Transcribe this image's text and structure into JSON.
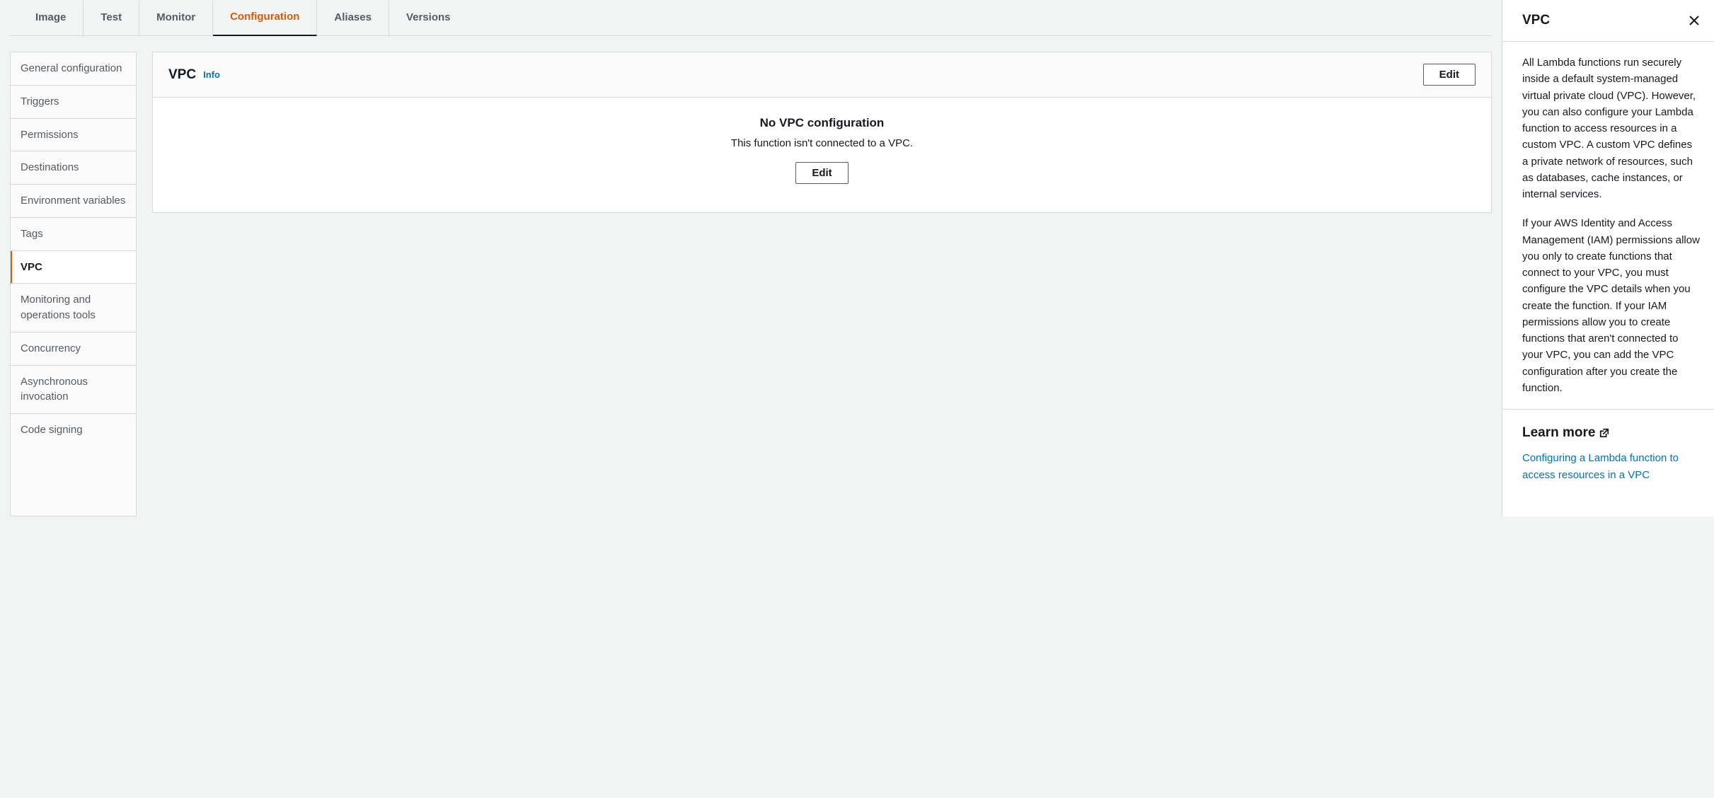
{
  "tabs": [
    {
      "label": "Image"
    },
    {
      "label": "Test"
    },
    {
      "label": "Monitor"
    },
    {
      "label": "Configuration"
    },
    {
      "label": "Aliases"
    },
    {
      "label": "Versions"
    }
  ],
  "sideNav": [
    {
      "label": "General configuration"
    },
    {
      "label": "Triggers"
    },
    {
      "label": "Permissions"
    },
    {
      "label": "Destinations"
    },
    {
      "label": "Environment variables"
    },
    {
      "label": "Tags"
    },
    {
      "label": "VPC"
    },
    {
      "label": "Monitoring and operations tools"
    },
    {
      "label": "Concurrency"
    },
    {
      "label": "Asynchronous invocation"
    },
    {
      "label": "Code signing"
    }
  ],
  "panel": {
    "title": "VPC",
    "infoLabel": "Info",
    "editLabel": "Edit",
    "emptyTitle": "No VPC configuration",
    "emptyText": "This function isn't connected to a VPC."
  },
  "help": {
    "title": "VPC",
    "para1": "All Lambda functions run securely inside a default system-managed virtual private cloud (VPC). However, you can also configure your Lambda function to access resources in a custom VPC. A custom VPC defines a private network of resources, such as databases, cache instances, or internal services.",
    "para2": "If your AWS Identity and Access Management (IAM) permissions allow you only to create functions that connect to your VPC, you must configure the VPC details when you create the function. If your IAM permissions allow you to create functions that aren't connected to your VPC, you can add the VPC configuration after you create the function.",
    "learnMoreLabel": "Learn more",
    "linkText": "Configuring a Lambda function to access resources in a VPC"
  }
}
